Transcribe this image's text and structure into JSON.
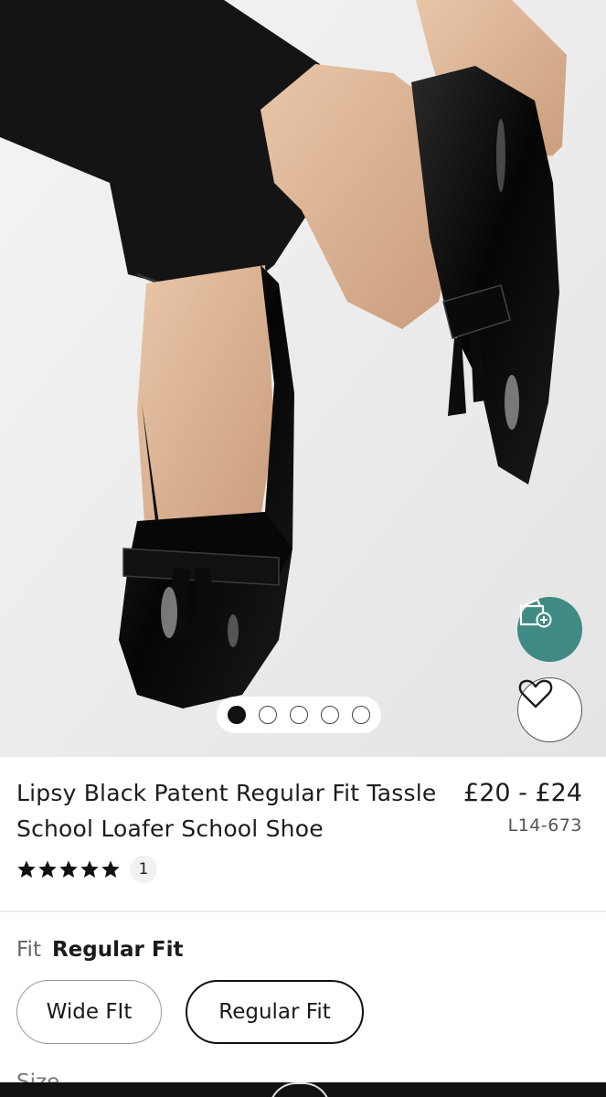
{
  "product": {
    "title": "Lipsy Black Patent Regular Fit Tassle School Loafer School Shoe",
    "price": "£20 - £24",
    "sku": "L14-673",
    "rating": 5,
    "rating_max": 5,
    "review_count": "1"
  },
  "gallery": {
    "image_count": 5,
    "active_index": 0
  },
  "actions": {
    "quick_icon": "bag-add-icon",
    "favourite_icon": "heart-icon",
    "accent_color": "#3f8a83"
  },
  "fit": {
    "label": "Fit",
    "selected": "Regular Fit",
    "options": [
      "Wide FIt",
      "Regular Fit"
    ]
  },
  "size": {
    "label": "Size"
  }
}
